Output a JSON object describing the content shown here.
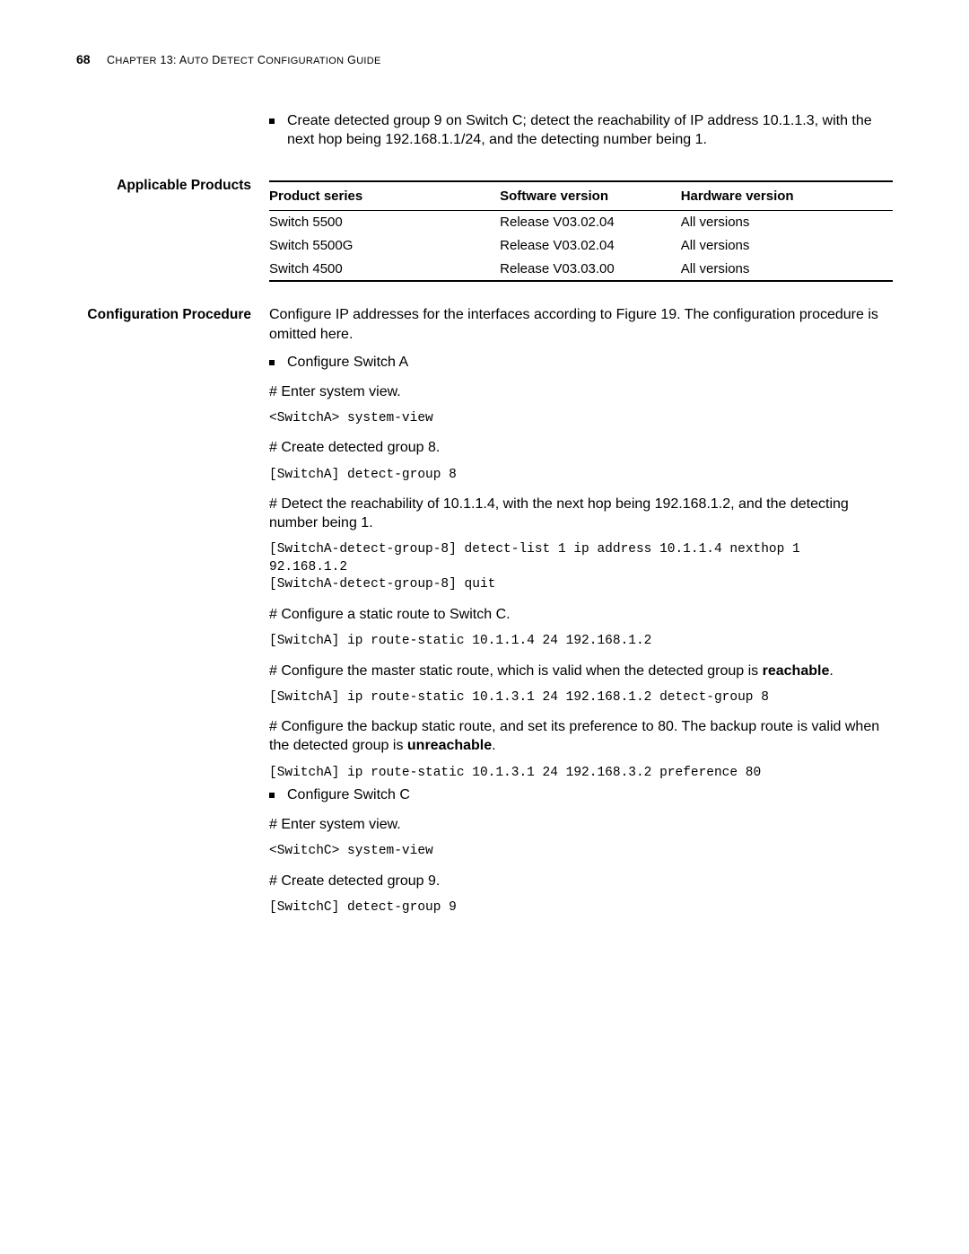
{
  "header": {
    "page_number": "68",
    "chapter_prefix": "C",
    "chapter_rest": "HAPTER",
    "chapter_num": " 13: A",
    "title_rest_1": "UTO",
    "title_d": " D",
    "title_rest_2": "ETECT",
    "title_c": " C",
    "title_rest_3": "ONFIGURATION",
    "title_g": " G",
    "title_rest_4": "UIDE"
  },
  "intro_bullet": "Create detected group 9 on Switch C; detect the reachability of IP address 10.1.1.3, with the next hop being 192.168.1.1/24, and the detecting number being 1.",
  "applicable_products_label": "Applicable Products",
  "table": {
    "headers": [
      "Product series",
      "Software version",
      "Hardware version"
    ],
    "rows": [
      [
        "Switch 5500",
        "Release V03.02.04",
        "All versions"
      ],
      [
        "Switch 5500G",
        "Release V03.02.04",
        "All versions"
      ],
      [
        "Switch 4500",
        "Release V03.03.00",
        "All versions"
      ]
    ]
  },
  "config_label": "Configuration Procedure",
  "config_intro": "Configure IP addresses for the interfaces according to Figure 19. The configuration procedure is omitted here.",
  "bullet_switch_a": "Configure Switch A",
  "step1": "# Enter system view.",
  "cmd1": "<SwitchA> system-view",
  "step2": "# Create detected group 8.",
  "cmd2": "[SwitchA] detect-group 8",
  "step3": "# Detect the reachability of 10.1.1.4, with the next hop being 192.168.1.2, and the detecting number being 1.",
  "cmd3": "[SwitchA-detect-group-8] detect-list 1 ip address 10.1.1.4 nexthop 1\n92.168.1.2\n[SwitchA-detect-group-8] quit",
  "step4": "# Configure a static route to Switch C.",
  "cmd4": "[SwitchA] ip route-static 10.1.1.4 24 192.168.1.2",
  "step5a": "# Configure the master static route, which is valid when the detected group is ",
  "step5b": "reachable",
  "step5c": ".",
  "cmd5": "[SwitchA] ip route-static 10.1.3.1 24 192.168.1.2 detect-group 8",
  "step6a": "# Configure the backup static route, and set its preference to 80. The backup route is valid when the detected group is ",
  "step6b": "unreachable",
  "step6c": ".",
  "cmd6": "[SwitchA] ip route-static 10.1.3.1 24 192.168.3.2 preference 80",
  "bullet_switch_c": "Configure Switch C",
  "step7": "# Enter system view.",
  "cmd7": "<SwitchC> system-view",
  "step8": "# Create detected group 9.",
  "cmd8": "[SwitchC] detect-group 9"
}
